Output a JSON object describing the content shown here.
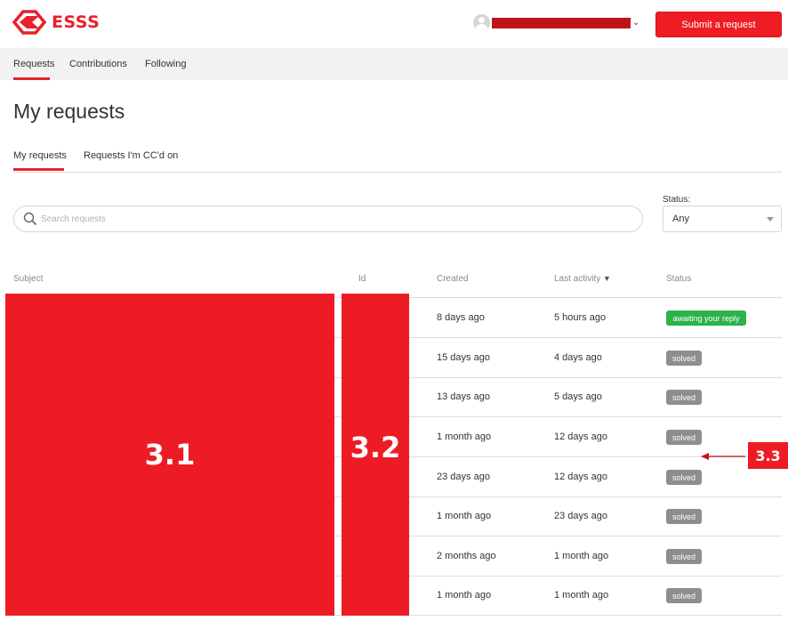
{
  "brand": {
    "name": "ESSS"
  },
  "header": {
    "submit_label": "Submit a request"
  },
  "subnav": {
    "items": [
      {
        "label": "Requests"
      },
      {
        "label": "Contributions"
      },
      {
        "label": "Following"
      }
    ]
  },
  "page": {
    "title": "My requests"
  },
  "tabs": [
    {
      "label": "My requests"
    },
    {
      "label": "Requests I'm CC'd on"
    }
  ],
  "search": {
    "placeholder": "Search requests"
  },
  "status_filter": {
    "label": "Status:",
    "value": "Any"
  },
  "table": {
    "columns": {
      "subject": "Subject",
      "id": "Id",
      "created": "Created",
      "last_activity": "Last activity",
      "sort_indicator": "▼",
      "status": "Status"
    },
    "rows": [
      {
        "created": "8 days ago",
        "last_activity": "5 hours ago",
        "status": "awaiting your reply"
      },
      {
        "created": "15 days ago",
        "last_activity": "4 days ago",
        "status": "solved"
      },
      {
        "created": "13 days ago",
        "last_activity": "5 days ago",
        "status": "solved"
      },
      {
        "created": "1 month ago",
        "last_activity": "12 days ago",
        "status": "solved"
      },
      {
        "created": "23 days ago",
        "last_activity": "12 days ago",
        "status": "solved"
      },
      {
        "created": "1 month ago",
        "last_activity": "23 days ago",
        "status": "solved"
      },
      {
        "created": "2 months ago",
        "last_activity": "1 month ago",
        "status": "solved"
      },
      {
        "created": "1 month ago",
        "last_activity": "1 month ago",
        "status": "solved"
      }
    ]
  },
  "annotations": {
    "subject_label": "3.1",
    "id_label": "3.2",
    "status_label": "3.3"
  },
  "colors": {
    "accent": "#ed1c24",
    "awaiting": "#2bb24c",
    "solved": "#8e8e8e"
  },
  "icons": {
    "logo": "esss-logo-icon",
    "avatar": "user-avatar-icon",
    "dropdown": "chevron-down-icon",
    "search": "search-icon"
  }
}
